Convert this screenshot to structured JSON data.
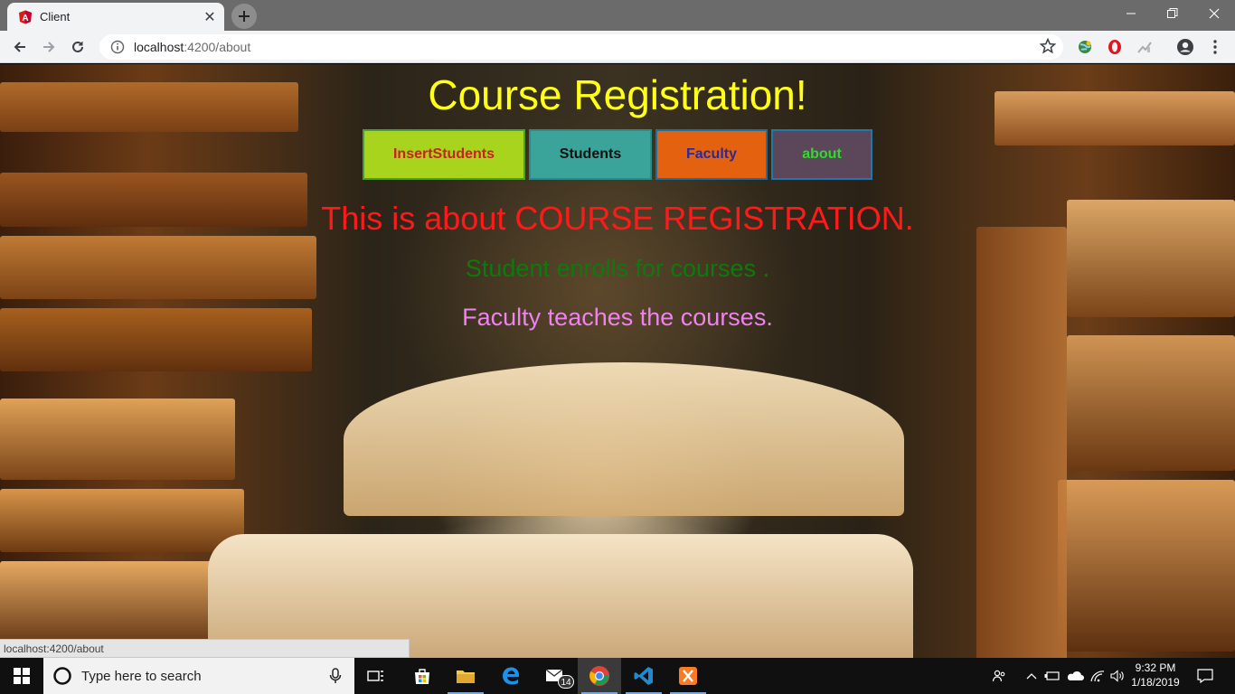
{
  "browser": {
    "tab_title": "Client",
    "url_host": "localhost",
    "url_rest": ":4200/about",
    "icons": {
      "favicon": "angular-icon",
      "close": "close-icon",
      "new_tab": "plus-icon",
      "back": "back-arrow-icon",
      "forward": "forward-arrow-icon",
      "reload": "reload-icon",
      "info": "info-icon",
      "bookmark": "star-icon",
      "menu": "kebab-menu-icon"
    }
  },
  "page": {
    "heading": "Course Registration!",
    "nav": [
      {
        "label": "InsertStudents",
        "bg": "#a8d41e",
        "color": "#cc2020",
        "border": "#4aa02c"
      },
      {
        "label": "Students",
        "bg": "#3aa39a",
        "color": "#111111",
        "border": "#2d8a84"
      },
      {
        "label": "Faculty",
        "bg": "#e4620f",
        "color": "#2a2a9a",
        "border": "#1d6fa0"
      },
      {
        "label": "about",
        "bg": "#5c4659",
        "color": "#2edb2e",
        "border": "#1e78a8"
      }
    ],
    "about_title": "This is about COURSE REGISTRATION.",
    "about_line1": "Student enrolls for courses .",
    "about_line2": "Faculty teaches the courses."
  },
  "status_url": "localhost:4200/about",
  "taskbar": {
    "search_placeholder": "Type here to search",
    "mail_badge": "14",
    "time": "9:32 PM",
    "date": "1/18/2019"
  }
}
